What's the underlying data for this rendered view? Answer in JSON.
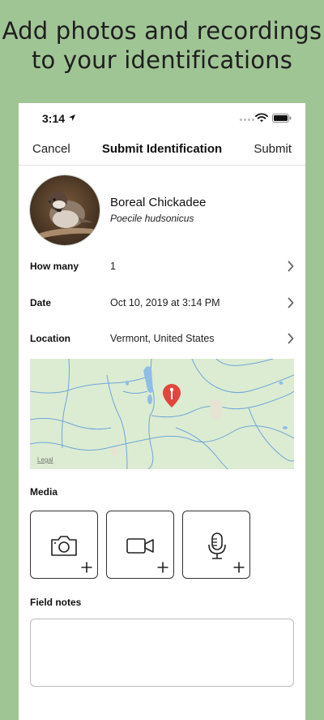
{
  "headline": {
    "line1": "Add photos and recordings",
    "line2": "to your identifications"
  },
  "status_bar": {
    "time": "3:14",
    "icons": [
      "location-arrow-icon",
      "signal-dots-icon",
      "wifi-icon",
      "battery-icon"
    ]
  },
  "nav": {
    "cancel_label": "Cancel",
    "title": "Submit Identification",
    "submit_label": "Submit"
  },
  "species": {
    "common_name": "Boreal Chickadee",
    "scientific_name": "Poecile hudsonicus"
  },
  "rows": [
    {
      "label": "How many",
      "value": "1"
    },
    {
      "label": "Date",
      "value": "Oct 10, 2019 at 3:14 PM"
    },
    {
      "label": "Location",
      "value": "Vermont, United States"
    }
  ],
  "map": {
    "legal_label": "Legal",
    "pin_color": "#e0463a"
  },
  "media": {
    "label": "Media",
    "buttons": [
      "camera-icon",
      "video-camera-icon",
      "microphone-icon"
    ]
  },
  "field_notes": {
    "label": "Field notes",
    "value": ""
  },
  "colors": {
    "background": "#a0c595",
    "card": "#ffffff",
    "map": "#dcecd2",
    "water": "#6fa6d8"
  }
}
